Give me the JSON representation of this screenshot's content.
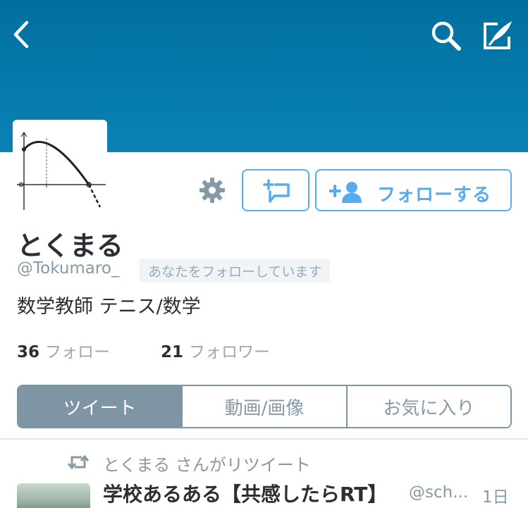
{
  "colors": {
    "banner": "#0a7aad",
    "accent": "#55acee",
    "segment_active": "#7f95a4"
  },
  "header": {
    "back_icon": "chevron-left-icon",
    "search_icon": "search-icon",
    "compose_icon": "compose-tweet-icon"
  },
  "profile": {
    "display_name": "とくまる",
    "handle": "@Tokumaro_",
    "follows_you": "あなたをフォローしています",
    "bio": "数学教師 テニス/数学",
    "following_count": "36",
    "following_label": "フォロー",
    "followers_count": "21",
    "followers_label": "フォロワー"
  },
  "actions": {
    "settings_icon": "gear-icon",
    "dm_icon": "direct-message-icon",
    "follow_label": "フォローする"
  },
  "tabs": [
    {
      "label": "ツイート",
      "active": true
    },
    {
      "label": "動画/画像",
      "active": false
    },
    {
      "label": "お気に入り",
      "active": false
    }
  ],
  "tweet": {
    "retweet_context": "とくまる さんがリツイート",
    "author": "学校あるある【共感したらRT】",
    "handle": "@sch...",
    "time": "1日"
  }
}
